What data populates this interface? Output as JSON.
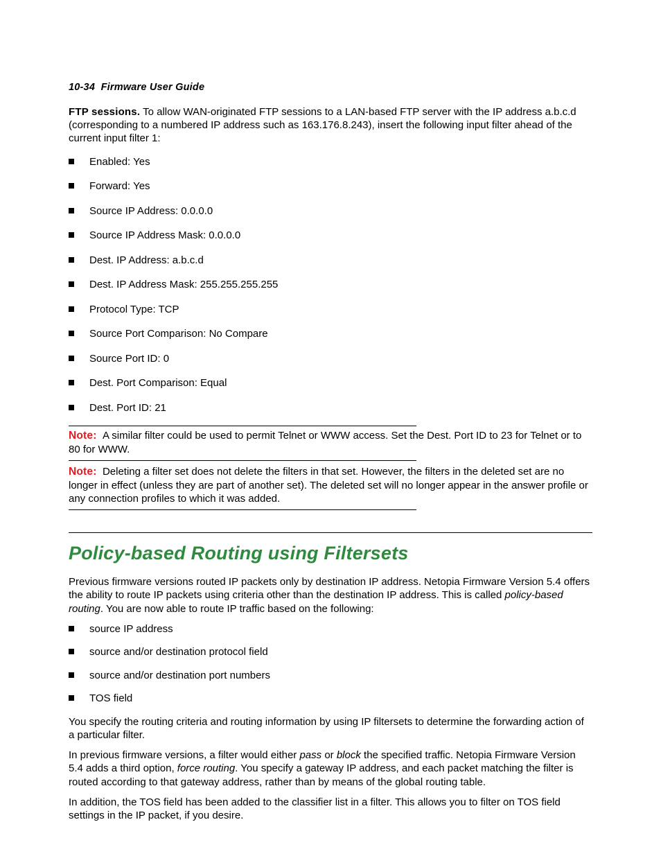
{
  "header": {
    "page_ref": "10-34",
    "guide_title": "Firmware User Guide"
  },
  "intro": {
    "lead": "FTP sessions.",
    "text": " To allow WAN-originated FTP sessions to a LAN-based FTP server with the IP address a.b.c.d (corresponding to a numbered IP address such as 163.176.8.243), insert the following input filter ahead of the current input filter 1:"
  },
  "filter_items": [
    "Enabled: Yes",
    "Forward: Yes",
    "Source IP Address: 0.0.0.0",
    "Source IP Address Mask: 0.0.0.0",
    "Dest. IP Address: a.b.c.d",
    "Dest. IP Address Mask: 255.255.255.255",
    "Protocol Type: TCP",
    "Source Port Comparison: No Compare",
    "Source Port ID: 0",
    "Dest. Port Comparison: Equal",
    "Dest. Port ID: 21"
  ],
  "note1": {
    "label": "Note:",
    "text": "A similar filter could be used to permit Telnet or WWW access. Set the Dest. Port ID to 23 for Telnet or to 80 for WWW."
  },
  "note2": {
    "label": "Note:",
    "text": "Deleting a filter set does not delete the filters in that set. However, the filters in the deleted set are no longer in effect (unless they are part of another set). The deleted set will no longer appear in the answer profile or any connection profiles to which it was added."
  },
  "section": {
    "title": "Policy-based Routing using Filtersets",
    "p1_a": "Previous firmware versions routed IP packets only by destination IP address. Netopia Firmware Version 5.4 offers the ability to route IP packets using criteria other than the destination IP address. This is called ",
    "p1_em": "policy-based routing",
    "p1_b": ". You are now able to route IP traffic based on the following:",
    "criteria": [
      "source IP address",
      "source and/or destination protocol field",
      "source and/or destination port numbers",
      "TOS field"
    ],
    "p2": "You specify the routing criteria and routing information by using IP filtersets to determine the forwarding action of a particular filter.",
    "p3_a": "In previous firmware versions, a filter would either ",
    "p3_em1": "pass",
    "p3_b": " or ",
    "p3_em2": "block",
    "p3_c": " the specified traffic. Netopia Firmware Version 5.4 adds a third option, ",
    "p3_em3": "force routing",
    "p3_d": ". You specify a gateway IP address, and each packet matching the filter is routed according to that gateway address, rather than by means of the global routing table.",
    "p4": "In addition, the TOS field has been added to the classifier list in a filter. This allows you to filter on TOS field settings in the IP packet, if you desire."
  }
}
